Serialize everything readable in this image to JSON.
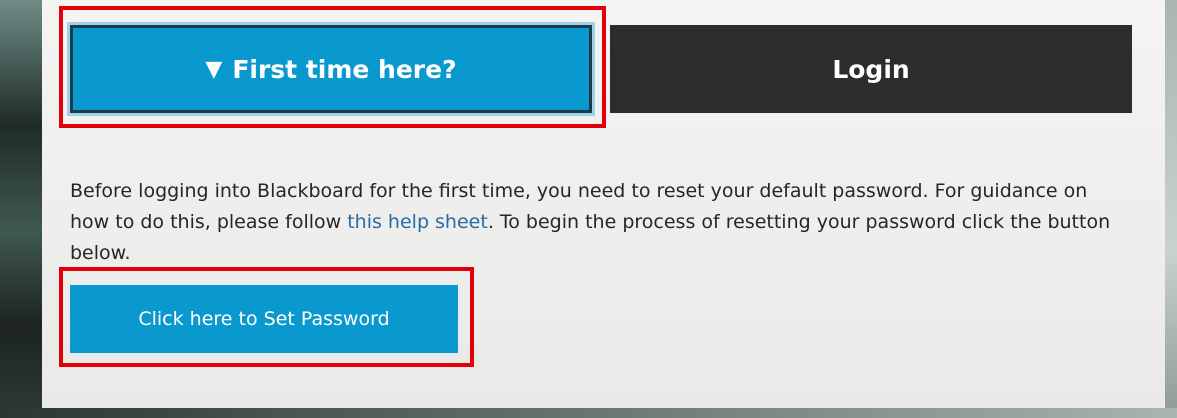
{
  "tabs": {
    "first_time_label": "First time here?",
    "first_time_icon": "triangle-down-icon",
    "first_time_arrow": "▼",
    "login_label": "Login"
  },
  "info": {
    "text_before_link": "Before logging into Blackboard for the first time, you need to reset your default password. For guidance on how to do this, please follow ",
    "link_text": "this help sheet",
    "text_after_link": ". To begin the process of resetting your password click the button below."
  },
  "set_password_button": {
    "label": "Click here to Set Password"
  },
  "colors": {
    "accent_blue": "#0a99cf",
    "login_dark": "#2c2c2c",
    "highlight_red": "#e3000b",
    "link_blue": "#2a6aa3"
  }
}
